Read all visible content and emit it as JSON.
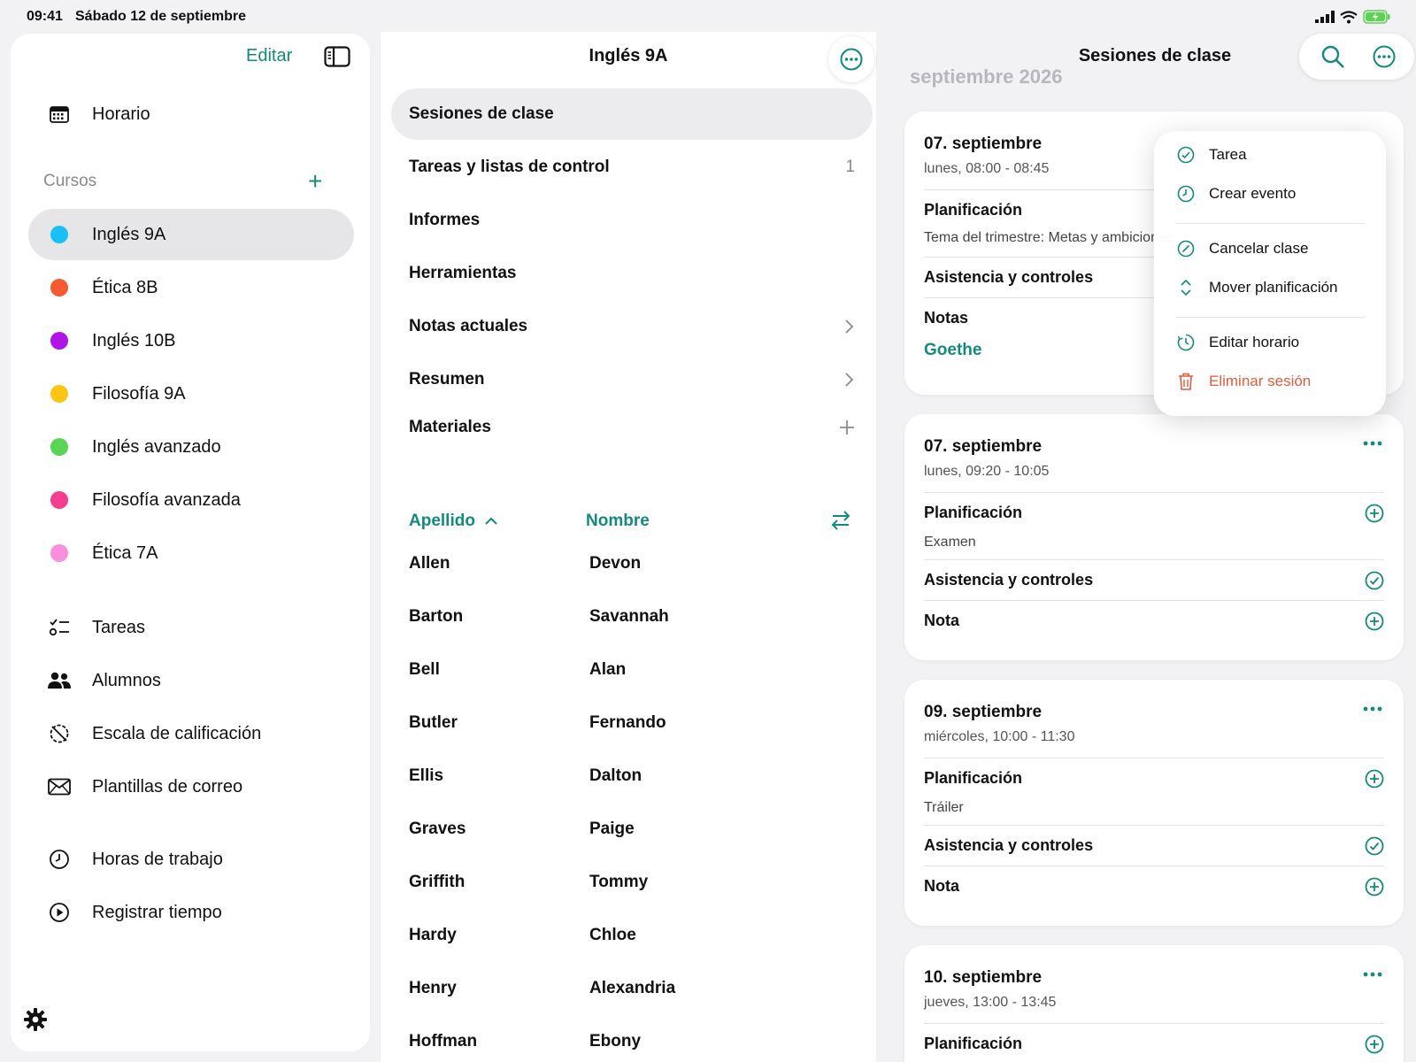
{
  "status_bar": {
    "time": "09:41",
    "date": "Sábado 12 de septiembre"
  },
  "colors": {
    "accent": "#14897d",
    "danger": "#e25b3a"
  },
  "sidebar": {
    "edit_label": "Editar",
    "top_items": [
      {
        "label": "Horario",
        "icon": "calendar-icon"
      }
    ],
    "courses_label": "Cursos",
    "courses": [
      {
        "label": "Inglés 9A",
        "color": "#18c0f5"
      },
      {
        "label": "Ética 8B",
        "color": "#f55a32"
      },
      {
        "label": "Inglés 10B",
        "color": "#b015e8"
      },
      {
        "label": "Filosofía 9A",
        "color": "#fcc514"
      },
      {
        "label": "Inglés avanzado",
        "color": "#5bd354"
      },
      {
        "label": "Filosofía avanzada",
        "color": "#f53e8d"
      },
      {
        "label": "Ética 7A",
        "color": "#fa8fde"
      }
    ],
    "tools": [
      {
        "label": "Tareas",
        "icon": "checklist-icon"
      },
      {
        "label": "Alumnos",
        "icon": "people-icon"
      },
      {
        "label": "Escala de calificación",
        "icon": "grade-scale-icon"
      },
      {
        "label": "Plantillas de correo",
        "icon": "envelope-icon"
      }
    ],
    "time": [
      {
        "label": "Horas de trabajo",
        "icon": "clock-icon"
      },
      {
        "label": "Registrar tiempo",
        "icon": "play-circle-icon"
      }
    ]
  },
  "course": {
    "title": "Inglés 9A",
    "nav": [
      {
        "label": "Sesiones de clase",
        "trail": ""
      },
      {
        "label": "Tareas y listas de control",
        "trail": "1"
      },
      {
        "label": "Informes",
        "trail": ""
      },
      {
        "label": "Herramientas",
        "trail": ""
      },
      {
        "label": "Notas actuales",
        "trail": ""
      },
      {
        "label": "Resumen",
        "trail": ""
      },
      {
        "label": "Materiales",
        "trail": ""
      }
    ],
    "sort": {
      "last_name_label": "Apellido",
      "first_name_label": "Nombre"
    },
    "students": [
      {
        "last": "Allen",
        "first": "Devon"
      },
      {
        "last": "Barton",
        "first": "Savannah"
      },
      {
        "last": "Bell",
        "first": "Alan"
      },
      {
        "last": "Butler",
        "first": "Fernando"
      },
      {
        "last": "Ellis",
        "first": "Dalton"
      },
      {
        "last": "Graves",
        "first": "Paige"
      },
      {
        "last": "Griffith",
        "first": "Tommy"
      },
      {
        "last": "Hardy",
        "first": "Chloe"
      },
      {
        "last": "Henry",
        "first": "Alexandria"
      },
      {
        "last": "Hoffman",
        "first": "Ebony"
      }
    ]
  },
  "sessions": {
    "title": "Sesiones de clase",
    "month_label": "septiembre 2026",
    "items": [
      {
        "date": "07. septiembre",
        "time": "lunes, 08:00 - 08:45",
        "planning_label": "Planificación",
        "planning_text": "Tema del trimestre: Metas y ambiciones",
        "attendance_label": "Asistencia y controles",
        "notes_label": "Notas",
        "notes_text": "Goethe"
      },
      {
        "date": "07. septiembre",
        "time": "lunes, 09:20 - 10:05",
        "planning_label": "Planificación",
        "planning_text": "Examen",
        "attendance_label": "Asistencia y controles",
        "notes_label": "Nota"
      },
      {
        "date": "09. septiembre",
        "time": "miércoles, 10:00 - 11:30",
        "planning_label": "Planificación",
        "planning_text": "Tráiler",
        "attendance_label": "Asistencia y controles",
        "notes_label": "Nota"
      },
      {
        "date": "10. septiembre",
        "time": "jueves, 13:00 - 13:45",
        "planning_label": "Planificación"
      }
    ]
  },
  "context_menu": {
    "items": [
      {
        "label": "Tarea",
        "icon": "check-circle-icon"
      },
      {
        "label": "Crear evento",
        "icon": "clock-icon"
      },
      {
        "label": "Cancelar clase",
        "icon": "cancel-circle-icon"
      },
      {
        "label": "Mover planificación",
        "icon": "chevron-updown-icon"
      },
      {
        "label": "Editar horario",
        "icon": "clock-edit-icon"
      },
      {
        "label": "Eliminar sesión",
        "icon": "trash-icon"
      }
    ]
  }
}
